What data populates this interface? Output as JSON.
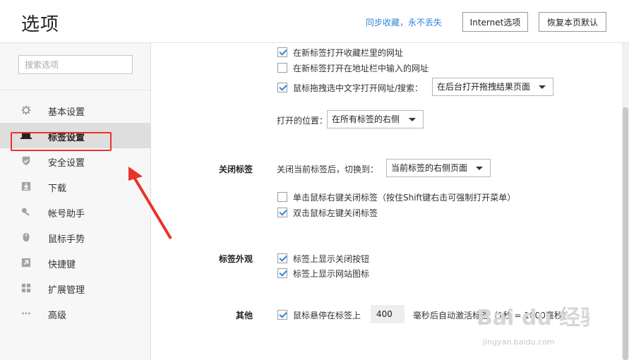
{
  "header": {
    "title": "选项",
    "sync_link": "同步收藏，永不丢失",
    "internet_options": "Internet选项",
    "restore_default": "恢复本页默认"
  },
  "sidebar": {
    "search_placeholder": "搜索选项",
    "items": [
      {
        "label": "基本设置",
        "icon": "gear-icon",
        "active": false
      },
      {
        "label": "标签设置",
        "icon": "laptop-icon",
        "active": true
      },
      {
        "label": "安全设置",
        "icon": "shield-icon",
        "active": false
      },
      {
        "label": "下载",
        "icon": "download-icon",
        "active": false
      },
      {
        "label": "帐号助手",
        "icon": "key-icon",
        "active": false
      },
      {
        "label": "鼠标手势",
        "icon": "mouse-icon",
        "active": false
      },
      {
        "label": "快捷键",
        "icon": "shortcut-arrow-icon",
        "active": false
      },
      {
        "label": "扩展管理",
        "icon": "grid-icon",
        "active": false
      },
      {
        "label": "高级",
        "icon": "more-dots-icon",
        "active": false
      }
    ]
  },
  "main": {
    "open_favorites_new_tab": {
      "label": "在新标签打开收藏栏里的网址",
      "checked": true
    },
    "open_address_new_tab": {
      "label": "在新标签打开在地址栏中输入的网址",
      "checked": false
    },
    "drag_text_open": {
      "label": "鼠标拖拽选中文字打开网址/搜索：",
      "checked": true
    },
    "drag_result_select": "在后台打开拖拽结果页面",
    "open_position_label": "打开的位置：",
    "open_position_select": "在所有标签的右侧",
    "close_tab_section": "关闭标签",
    "after_close_label": "关闭当前标签后，切换到：",
    "after_close_select": "当前标签的右侧页面",
    "right_click_close": {
      "label": "单击鼠标右键关闭标签（按住Shift键右击可强制打开菜单）",
      "checked": false
    },
    "double_click_close": {
      "label": "双击鼠标左键关闭标签",
      "checked": true
    },
    "appearance_section": "标签外观",
    "show_close_button": {
      "label": "标签上显示关闭按钮",
      "checked": true
    },
    "show_site_icon": {
      "label": "标签上显示网站图标",
      "checked": true
    },
    "other_section": "其他",
    "hover_activate": {
      "label": "鼠标悬停在标签上",
      "checked": true
    },
    "hover_ms_value": "400",
    "hover_suffix": "毫秒后自动激活标签（1秒 = 1000毫秒）"
  },
  "annotation": {
    "highlight_color": "#e8322b"
  },
  "watermark": {
    "text": "Bai du 经验",
    "url": "jingyan.baidu.com"
  },
  "colors": {
    "accent": "#2f86d9",
    "active_nav": "#dedede"
  }
}
